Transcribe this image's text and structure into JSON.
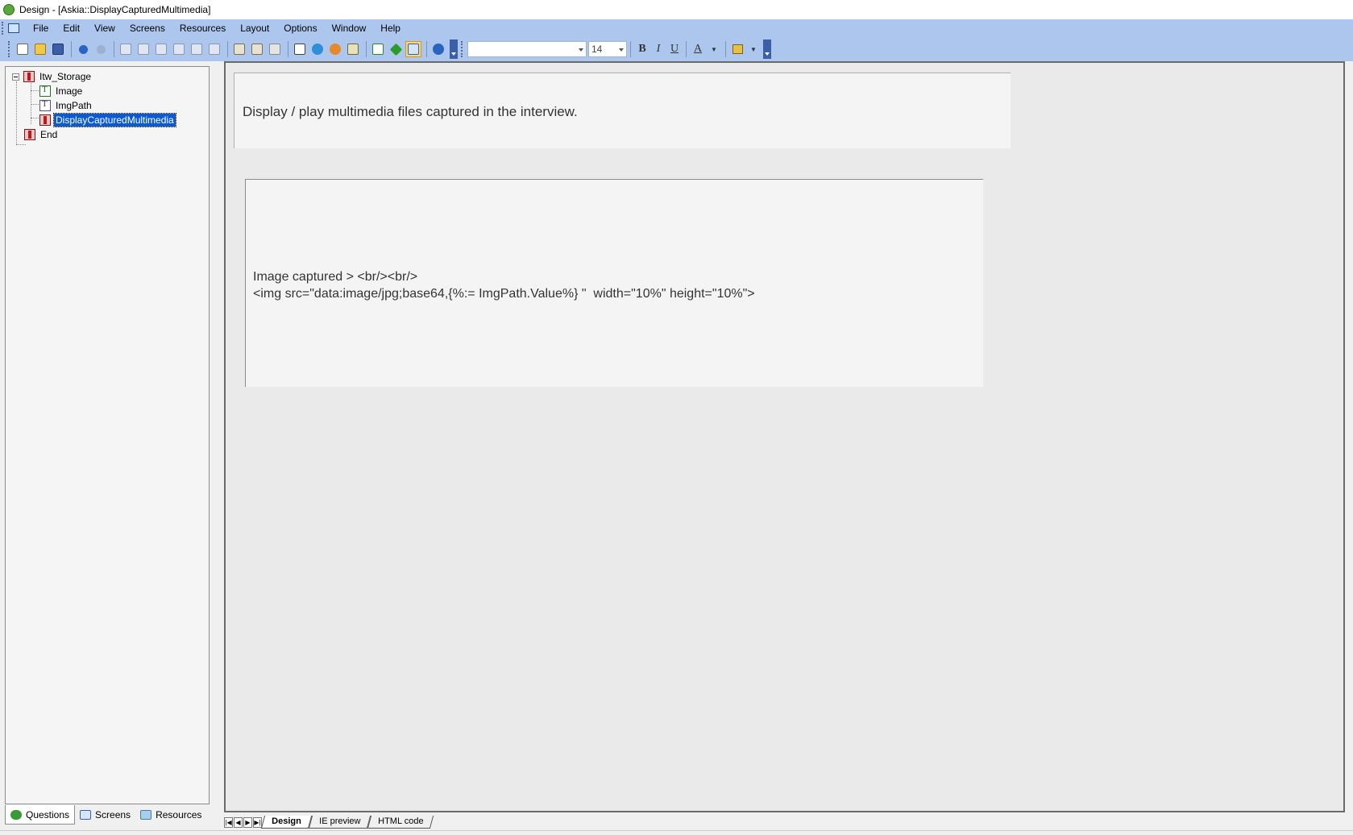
{
  "window": {
    "title": "Design - [Askia::DisplayCapturedMultimedia]"
  },
  "menubar": {
    "items": [
      "File",
      "Edit",
      "View",
      "Screens",
      "Resources",
      "Layout",
      "Options",
      "Window",
      "Help"
    ]
  },
  "toolbar": {
    "font_name": "",
    "font_size": "14",
    "bold_label": "B",
    "italic_label": "I",
    "underline_label": "U",
    "font_color_label": "A"
  },
  "tree": {
    "items": [
      {
        "label": "Itw_Storage",
        "type": "chapter",
        "level": 0
      },
      {
        "label": "Image",
        "type": "open",
        "level": 1
      },
      {
        "label": "ImgPath",
        "type": "open",
        "level": 1
      },
      {
        "label": "DisplayCapturedMultimedia",
        "type": "chapter",
        "level": 1,
        "selected": true
      },
      {
        "label": "End",
        "type": "chapter",
        "level": 0
      }
    ]
  },
  "left_tabs": [
    "Questions",
    "Screens",
    "Resources"
  ],
  "designer": {
    "question_text": "Display / play multimedia files captured in the interview.",
    "control_text_line1": "Image captured > <br/><br/>",
    "control_text_line2": "<img src=\"data:image/jpg;base64,{%:= ImgPath.Value%} \"  width=\"10%\" height=\"10%\">"
  },
  "bottom_tabs": [
    "Design",
    "IE preview",
    "HTML code"
  ],
  "colors": {
    "chrome": "#adc6ee",
    "selection": "#0a5ad4",
    "designer_bg": "#eaeaea"
  }
}
